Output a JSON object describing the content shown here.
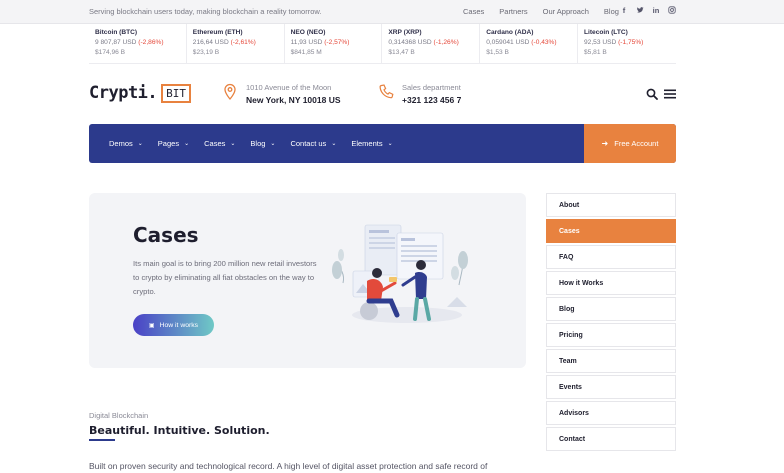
{
  "topbar": {
    "tagline": "Serving blockchain users today, making blockchain a reality tomorrow.",
    "links": [
      "Cases",
      "Partners",
      "Our Approach",
      "Blog"
    ],
    "social": [
      "facebook-icon",
      "twitter-icon",
      "linkedin-icon",
      "instagram-icon"
    ]
  },
  "ticker": [
    {
      "name": "Bitcoin (BTC)",
      "price": "9 807,87 USD",
      "change": "(-2,86%)",
      "cap": "$174,96 B"
    },
    {
      "name": "Ethereum (ETH)",
      "price": "216,64 USD",
      "change": "(-2,61%)",
      "cap": "$23,19 B"
    },
    {
      "name": "NEO (NEO)",
      "price": "11,93 USD",
      "change": "(-2,57%)",
      "cap": "$841,85 M"
    },
    {
      "name": "XRP (XRP)",
      "price": "0,314368 USD",
      "change": "(-1,26%)",
      "cap": "$13,47 B"
    },
    {
      "name": "Cardano (ADA)",
      "price": "0,059041 USD",
      "change": "(-0,43%)",
      "cap": "$1,53 B"
    },
    {
      "name": "Litecoin (LTC)",
      "price": "92,53 USD",
      "change": "(-1,75%)",
      "cap": "$5,81 B"
    }
  ],
  "header": {
    "logo_word": "Crypti.",
    "logo_box": "BIT",
    "address_line1": "1010 Avenue of the Moon",
    "address_line2": "New York, NY 10018 US",
    "sales_line1": "Sales department",
    "sales_line2": "+321 123 456 7"
  },
  "nav": {
    "items": [
      "Demos",
      "Pages",
      "Cases",
      "Blog",
      "Contact us",
      "Elements"
    ],
    "cta": "Free Account"
  },
  "hero": {
    "title": "Cases",
    "description": "Its main goal is to bring 200 million new retail investors to crypto by eliminating all fiat obstacles on the way to crypto.",
    "button": "How it works"
  },
  "sidebar": {
    "items": [
      "About",
      "Cases",
      "FAQ",
      "How it Works",
      "Blog",
      "Pricing",
      "Team",
      "Events",
      "Advisors",
      "Contact"
    ],
    "active": "Cases"
  },
  "content": {
    "kicker": "Digital Blockchain",
    "heading": "Beautiful. Intuitive. Solution.",
    "body": "Built on proven security and technological record. A high level of digital asset protection and safe record of"
  },
  "colors": {
    "nav_bg": "#2c3a8c",
    "accent": "#e8823f",
    "negative": "#e5483a"
  }
}
